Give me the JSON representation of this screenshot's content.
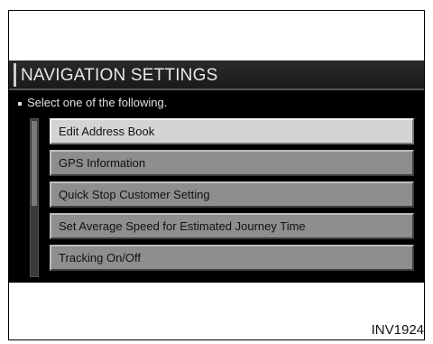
{
  "screen": {
    "title": "NAVIGATION SETTINGS",
    "prompt": "Select one of the following.",
    "menu_items": [
      {
        "label": "Edit Address Book",
        "selected": true
      },
      {
        "label": "GPS Information",
        "selected": false
      },
      {
        "label": "Quick Stop Customer Setting",
        "selected": false
      },
      {
        "label": "Set Average Speed for Estimated Journey Time",
        "selected": false
      },
      {
        "label": "Tracking On/Off",
        "selected": false
      }
    ]
  },
  "figure_id": "INV1924",
  "colors": {
    "screen_background": "#000000",
    "item_background": "#8e8e8e",
    "selected_item_background": "#d4d4d4"
  }
}
